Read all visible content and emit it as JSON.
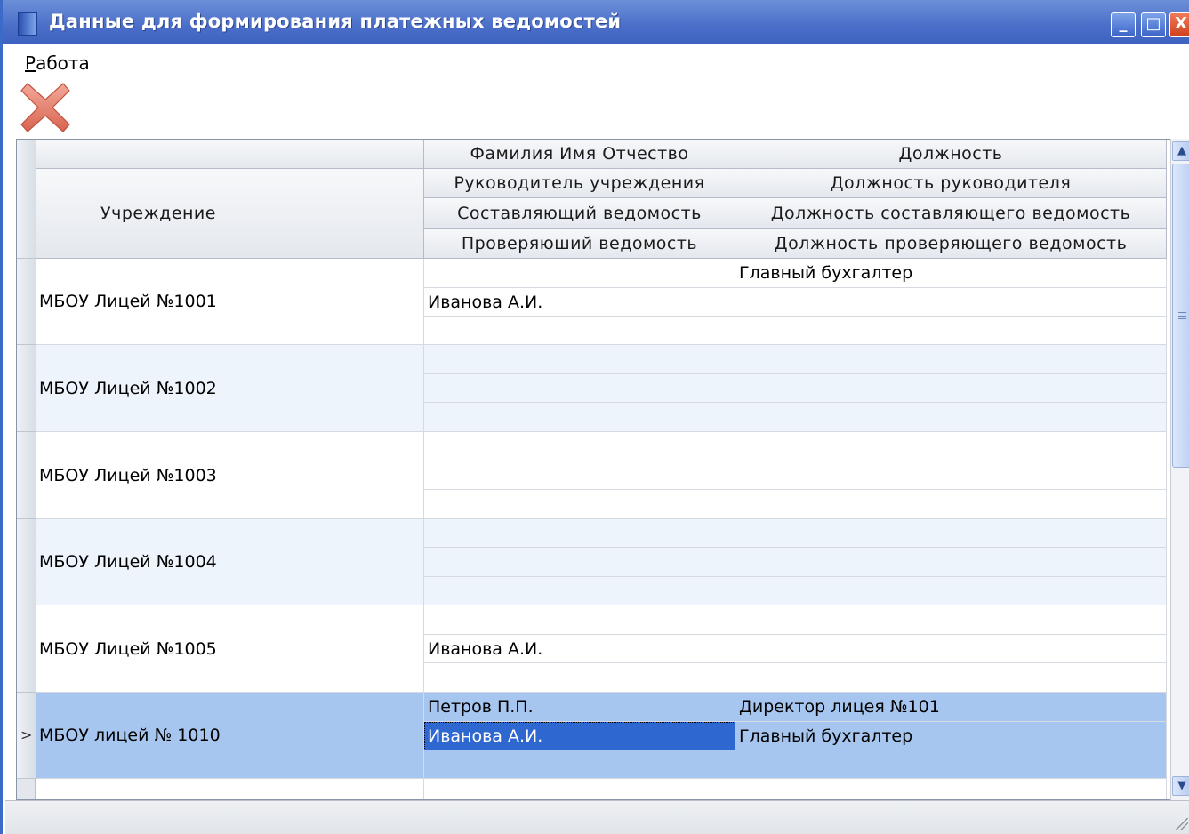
{
  "window": {
    "title": "Данные для формирования платежных ведомостей",
    "buttons": {
      "minimize": "_",
      "maximize": "□",
      "close": "X"
    }
  },
  "menu": {
    "items": [
      {
        "label": "Работа",
        "mnemonic": "Р",
        "rest": "абота"
      }
    ]
  },
  "toolbar": {
    "delete_icon": "delete-x-icon"
  },
  "grid": {
    "headers": {
      "institution": "Учреждение",
      "fio": "Фамилия Имя Отчество",
      "position": "Должность",
      "head": "Руководитель учреждения",
      "head_position": "Должность руководителя",
      "composer": "Составляющий ведомость",
      "composer_position": "Должность составляющего ведомость",
      "checker": "Проверяюший ведомость",
      "checker_position": "Должность проверяющего ведомость",
      "sort_indicator": "Δ"
    },
    "rows": [
      {
        "institution": "МБОУ Лицей №1001",
        "fio": [
          "",
          "Иванова А.И.",
          ""
        ],
        "position": [
          "Главный бухгалтер",
          "",
          ""
        ]
      },
      {
        "institution": "МБОУ Лицей №1002",
        "fio": [
          "",
          "",
          ""
        ],
        "position": [
          "",
          "",
          ""
        ]
      },
      {
        "institution": "МБОУ Лицей №1003",
        "fio": [
          "",
          "",
          ""
        ],
        "position": [
          "",
          "",
          ""
        ]
      },
      {
        "institution": "МБОУ Лицей №1004",
        "fio": [
          "",
          "",
          ""
        ],
        "position": [
          "",
          "",
          ""
        ]
      },
      {
        "institution": "МБОУ Лицей №1005",
        "fio": [
          "",
          "Иванова А.И.",
          ""
        ],
        "position": [
          "",
          "",
          ""
        ]
      },
      {
        "institution": "МБОУ лицей № 1010",
        "fio": [
          "Петров П.П.",
          "Иванова А.И.",
          ""
        ],
        "position": [
          "Директор лицея №101",
          "Главный бухгалтер",
          ""
        ]
      }
    ],
    "current_row_marker": ">",
    "selected_row": 5,
    "selected_cell": "fio-1"
  },
  "colors": {
    "title_bar": "#4a6ec8",
    "alt_row": "#eef4fc",
    "selected_row": "#a6c6ef",
    "selected_cell": "#2f67d0"
  },
  "scrollbar": {
    "up": "▲",
    "down": "▼"
  }
}
